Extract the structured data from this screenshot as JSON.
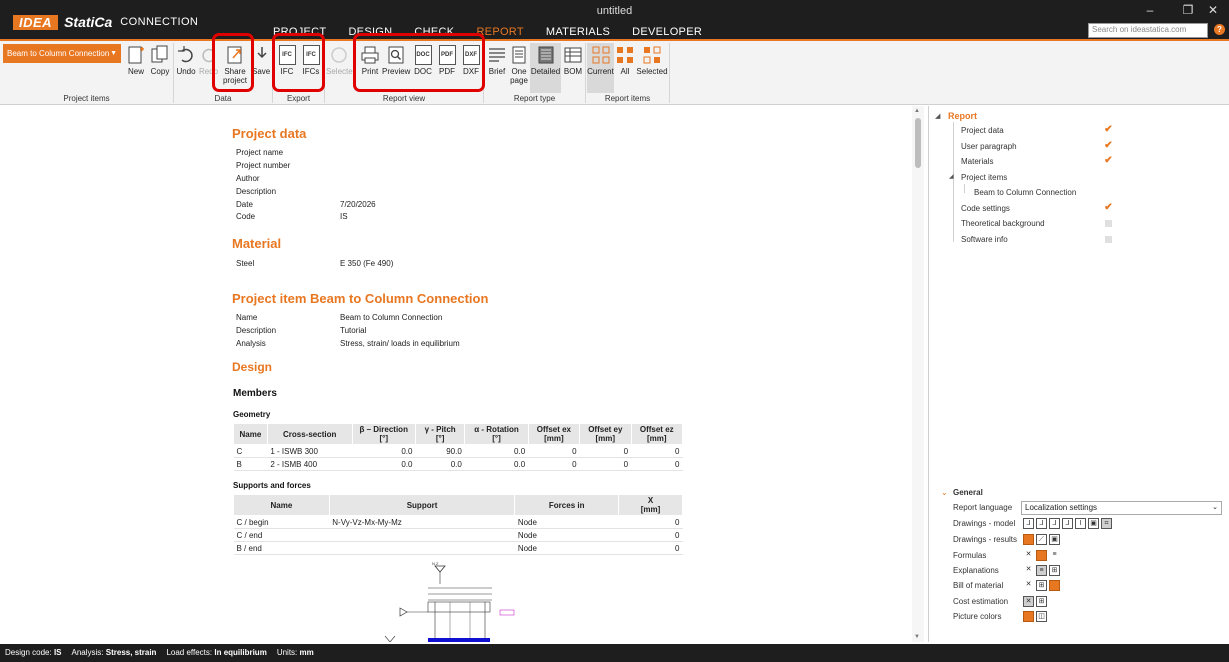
{
  "app": {
    "brand_idea": "IDEA",
    "brand_statica": "StatiCa",
    "brand_product": "CONNECTION",
    "window_title": "untitled",
    "search_placeholder": "Search on ideastatica.com",
    "help": "?"
  },
  "tabs": [
    "PROJECT",
    "DESIGN",
    "CHECK",
    "REPORT",
    "MATERIALS",
    "DEVELOPER"
  ],
  "active_tab": "REPORT",
  "ribbon": {
    "project_item": "Beam to Column Connection",
    "new": "New",
    "copy": "Copy",
    "undo": "Undo",
    "redo": "Redo",
    "share_1": "Share",
    "share_2": "project",
    "save": "Save",
    "ifc": "IFC",
    "ifcs": "IFCs",
    "selected_disabled": "Selecte",
    "print": "Print",
    "preview": "Preview",
    "doc": "DOC",
    "pdf": "PDF",
    "dxf": "DXF",
    "brief": "Brief",
    "one_page_1": "One",
    "one_page_2": "page",
    "detailed": "Detailed",
    "bom": "BOM",
    "current": "Current",
    "all": "All",
    "selected": "Selected",
    "groups": {
      "project_items": "Project items",
      "data": "Data",
      "export": "Export",
      "report_view": "Report view",
      "report_type": "Report type",
      "report_items": "Report items"
    },
    "accent": "#e87722",
    "highlight": "#e00000"
  },
  "report": {
    "project_data_title": "Project data",
    "project_fields": [
      {
        "k": "Project name",
        "v": ""
      },
      {
        "k": "Project number",
        "v": ""
      },
      {
        "k": "Author",
        "v": ""
      },
      {
        "k": "Description",
        "v": ""
      },
      {
        "k": "Date",
        "v": "7/20/2026"
      },
      {
        "k": "Code",
        "v": "IS"
      }
    ],
    "material_title": "Material",
    "material_key": "Steel",
    "material_val": "E 350 (Fe 490)",
    "item_title": "Project item Beam to Column Connection",
    "item_fields": [
      {
        "k": "Name",
        "v": "Beam to Column Connection"
      },
      {
        "k": "Description",
        "v": "Tutorial"
      },
      {
        "k": "Analysis",
        "v": "Stress, strain/ loads in equilibrium"
      }
    ],
    "design_title": "Design",
    "members_title": "Members",
    "geometry_title": "Geometry",
    "geometry_headers": [
      "Name",
      "Cross-section",
      "β – Direction",
      "γ - Pitch",
      "α - Rotation",
      "Offset ex",
      "Offset ey",
      "Offset ez"
    ],
    "geometry_units": [
      "",
      "",
      "[°]",
      "[°]",
      "[°]",
      "[mm]",
      "[mm]",
      "[mm]"
    ],
    "geometry_rows": [
      [
        "C",
        "1 - ISWB 300",
        "0.0",
        "90.0",
        "0.0",
        "0",
        "0",
        "0"
      ],
      [
        "B",
        "2 - ISMB 400",
        "0.0",
        "0.0",
        "0.0",
        "0",
        "0",
        "0"
      ]
    ],
    "supports_title": "Supports and forces",
    "supports_headers": [
      "Name",
      "Support",
      "Forces in",
      "X"
    ],
    "supports_units": [
      "",
      "",
      "",
      "[mm]"
    ],
    "supports_rows": [
      [
        "C / begin",
        "N-Vy-Vz-Mx-My-Mz",
        "Node",
        "0"
      ],
      [
        "C / end",
        "",
        "Node",
        "0"
      ],
      [
        "B / end",
        "",
        "Node",
        "0"
      ]
    ],
    "drawing_label": "N.Z"
  },
  "side": {
    "tree_root": "Report",
    "tree": [
      {
        "label": "Project data",
        "checked": true
      },
      {
        "label": "User paragraph",
        "checked": true
      },
      {
        "label": "Materials",
        "checked": true
      },
      {
        "label": "Project items",
        "checked": null
      },
      {
        "label": "Beam to Column Connection",
        "checked": null
      },
      {
        "label": "Code settings",
        "checked": true
      },
      {
        "label": "Theoretical background",
        "checked": false
      },
      {
        "label": "Software info",
        "checked": false
      }
    ],
    "general_title": "General",
    "report_language_label": "Report language",
    "report_language_value": "Localization settings",
    "options": [
      {
        "label": "Drawings - model",
        "icons": [
          "axes-icon",
          "axes-2-icon",
          "axes-3-icon",
          "axes-4-icon",
          "section-icon",
          "image-icon",
          "crop-icon"
        ]
      },
      {
        "label": "Drawings - results",
        "icons": [
          "results-icon",
          "chart-icon",
          "picture-icon"
        ]
      },
      {
        "label": "Formulas",
        "icons": [
          "none-icon",
          "list-selected-icon",
          "list-icon"
        ]
      },
      {
        "label": "Explanations",
        "icons": [
          "none-icon",
          "list-icon",
          "table-icon"
        ]
      },
      {
        "label": "Bill of material",
        "icons": [
          "none-icon",
          "table-icon",
          "table-selected-icon"
        ]
      },
      {
        "label": "Cost estimation",
        "icons": [
          "none-icon",
          "table-icon"
        ]
      },
      {
        "label": "Picture colors",
        "icons": [
          "color-icon",
          "cube-icon"
        ]
      }
    ]
  },
  "status": {
    "design_code_label": "Design code:",
    "design_code": "IS",
    "analysis_label": "Analysis:",
    "analysis": "Stress, strain",
    "load_label": "Load effects:",
    "load": "In equilibrium",
    "units_label": "Units:",
    "units": "mm"
  }
}
